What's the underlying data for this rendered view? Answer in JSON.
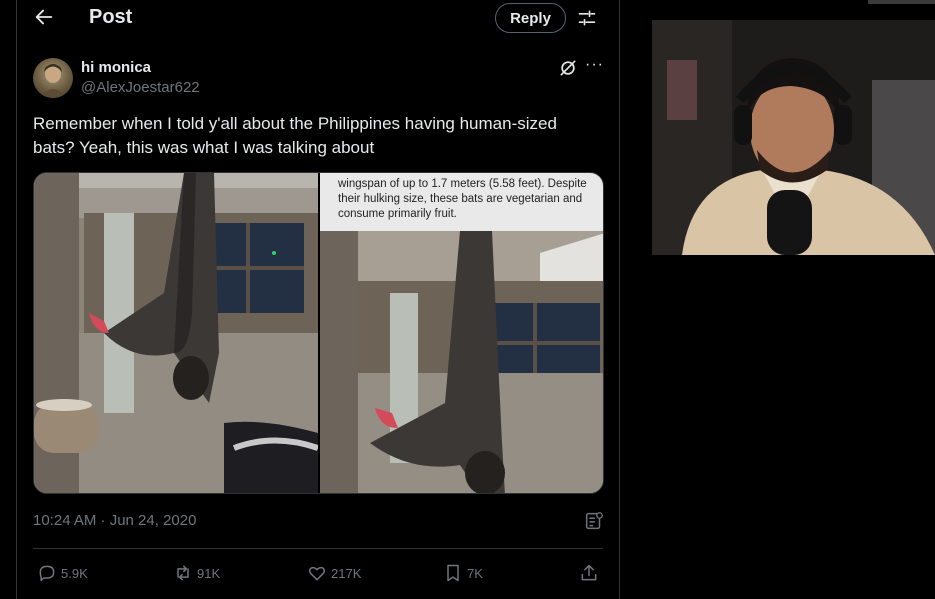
{
  "header": {
    "title": "Post",
    "reply_label": "Reply"
  },
  "tweet": {
    "author_name": "hi monica",
    "author_handle": "@AlexJoestar622",
    "text": "Remember when I told y'all about the Philippines having human-sized bats? Yeah, this was what I was talking about",
    "media_caption": "wingspan of up to 1.7 meters (5.58 feet). Despite their hulking size, these bats are vegetarian and consume primarily fruit.",
    "timestamp": "10:24 AM · Jun 24, 2020",
    "more_label": "···"
  },
  "actions": {
    "replies": "5.9K",
    "reposts": "91K",
    "likes": "217K",
    "bookmarks": "7K"
  },
  "colors": {
    "background": "#000000",
    "text": "#e7e9ea",
    "muted": "#71767b",
    "border": "#2f3336"
  },
  "icons": [
    "back-arrow-icon",
    "filter-icon",
    "grok-icon",
    "more-icon",
    "analytics-icon",
    "reply-icon",
    "repost-icon",
    "like-icon",
    "bookmark-icon",
    "share-icon"
  ]
}
